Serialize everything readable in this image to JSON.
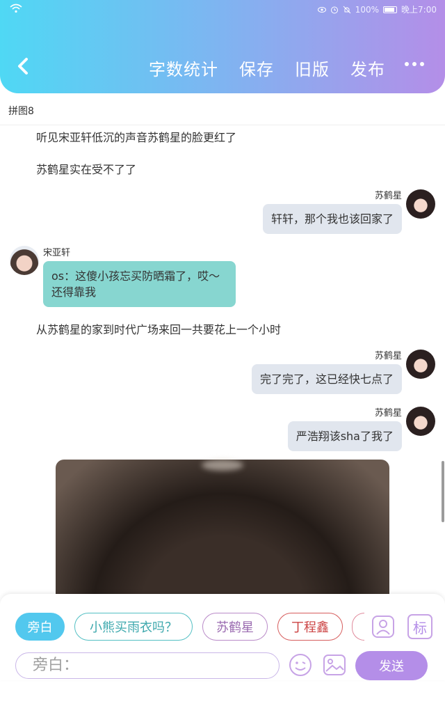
{
  "status_bar": {
    "battery": "100%",
    "time": "晚上7:00"
  },
  "header": {
    "nav": [
      "字数统计",
      "保存",
      "旧版",
      "发布"
    ],
    "icons": [
      "back-icon",
      "more-icon"
    ]
  },
  "doc_title": "拼图8",
  "messages": {
    "narr1": "听见宋亚轩低沉的声音苏鹤星的脸更红了",
    "narr2": "苏鹤星实在受不了了",
    "m1_name": "苏鹤星",
    "m1_text": "轩轩，那个我也该回家了",
    "m2_name": "宋亚轩",
    "m2_text": "os：这傻小孩忘买防晒霜了，哎～还得靠我",
    "narr3": "从苏鹤星的家到时代广场来回一共要花上一个小时",
    "m3_name": "苏鹤星",
    "m3_text": "完了完了，这已经快七点了",
    "m4_name": "苏鹤星",
    "m4_text": "严浩翔该sha了我了"
  },
  "bottom": {
    "chips": [
      "旁白",
      "小熊买雨衣吗？",
      "苏鹤星",
      "丁程鑫"
    ],
    "input_placeholder": "旁白：",
    "send": "发送",
    "icons": [
      "role-icon",
      "tag-icon",
      "emoji-icon",
      "image-icon"
    ],
    "tag_label": "标"
  },
  "colors": {
    "header_start": "#4fd8f4",
    "header_end": "#b48ee8",
    "bubble_right": "#e1e6ee",
    "bubble_left": "#87d6d0",
    "send": "#b48ee8"
  }
}
